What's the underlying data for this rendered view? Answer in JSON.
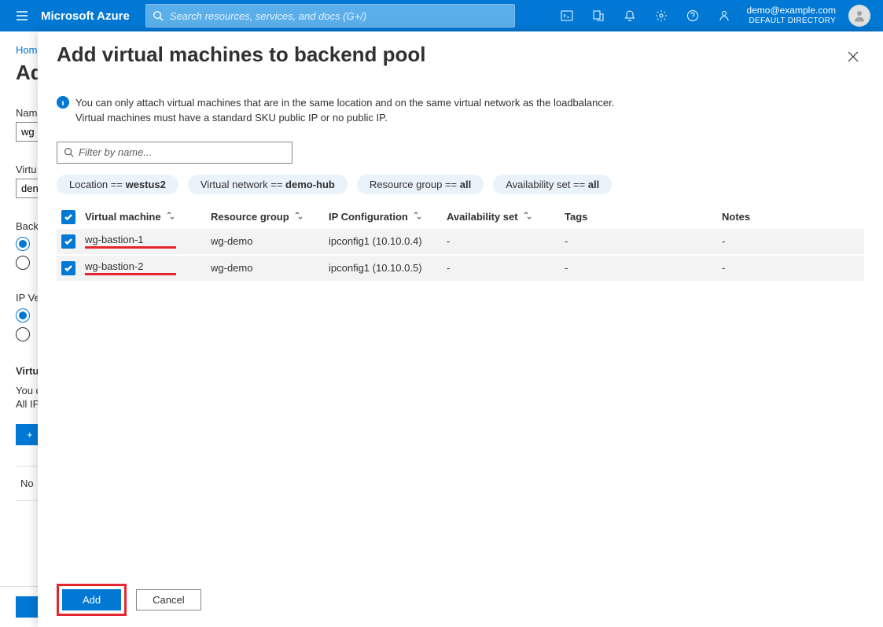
{
  "header": {
    "brand": "Microsoft Azure",
    "search_placeholder": "Search resources, services, and docs (G+/)",
    "user_email": "demo@example.com",
    "user_directory": "DEFAULT DIRECTORY"
  },
  "background": {
    "breadcrumb": "Home",
    "title_frag": "Ad",
    "name_label": "Nam",
    "name_val": "wg",
    "vnet_label": "Virtu",
    "vnet_val": "den",
    "backend_label": "Backe",
    "ipver_label": "IP Ve",
    "vm_head": "Virtu",
    "note1": "You c",
    "note2": "All IP",
    "norows": "No",
    "add_btn": "+"
  },
  "panel": {
    "title": "Add virtual machines to backend pool",
    "info_line1": "You can only attach virtual machines that are in the same location and on the same virtual network as the loadbalancer.",
    "info_line2": "Virtual machines must have a standard SKU public IP or no public IP.",
    "filter_placeholder": "Filter by name...",
    "pills": [
      {
        "key": "Location == ",
        "val": "westus2"
      },
      {
        "key": "Virtual network == ",
        "val": "demo-hub"
      },
      {
        "key": "Resource group == ",
        "val": "all"
      },
      {
        "key": "Availability set == ",
        "val": "all"
      }
    ],
    "columns": {
      "vm": "Virtual machine",
      "rg": "Resource group",
      "ip": "IP Configuration",
      "avail": "Availability set",
      "tags": "Tags",
      "notes": "Notes"
    },
    "rows": [
      {
        "checked": true,
        "vm": "wg-bastion-1",
        "rg": "wg-demo",
        "ip": "ipconfig1 (10.10.0.4)",
        "avail": "-",
        "tags": "-",
        "notes": "-"
      },
      {
        "checked": true,
        "vm": "wg-bastion-2",
        "rg": "wg-demo",
        "ip": "ipconfig1 (10.10.0.5)",
        "avail": "-",
        "tags": "-",
        "notes": "-"
      }
    ],
    "add_label": "Add",
    "cancel_label": "Cancel"
  }
}
